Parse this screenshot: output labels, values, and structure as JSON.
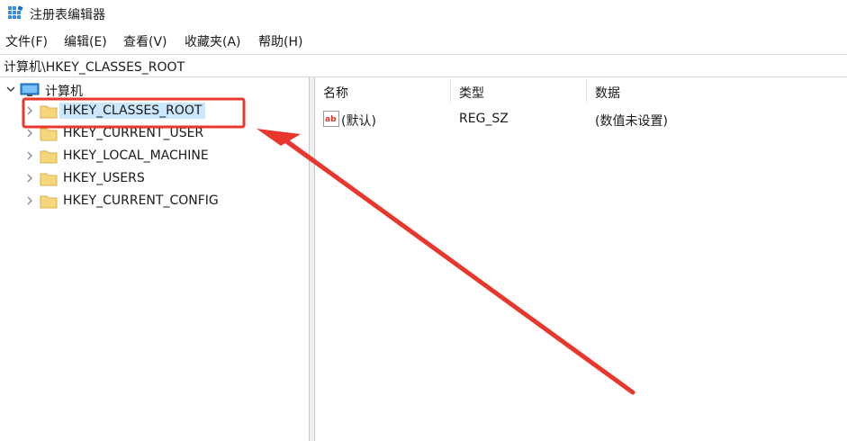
{
  "window": {
    "title": "注册表编辑器"
  },
  "menu": [
    {
      "label": "文件(F)"
    },
    {
      "label": "编辑(E)"
    },
    {
      "label": "查看(V)"
    },
    {
      "label": "收藏夹(A)"
    },
    {
      "label": "帮助(H)"
    }
  ],
  "address": {
    "path": "计算机\\HKEY_CLASSES_ROOT"
  },
  "tree": {
    "root": "计算机",
    "items": [
      {
        "label": "HKEY_CLASSES_ROOT",
        "selected": true
      },
      {
        "label": "HKEY_CURRENT_USER"
      },
      {
        "label": "HKEY_LOCAL_MACHINE"
      },
      {
        "label": "HKEY_USERS"
      },
      {
        "label": "HKEY_CURRENT_CONFIG"
      }
    ]
  },
  "values": {
    "columns": [
      "名称",
      "类型",
      "数据"
    ],
    "rows": [
      {
        "name": "(默认)",
        "type": "REG_SZ",
        "data": "(数值未设置)"
      }
    ]
  },
  "annotation": {
    "color": "#e8372c",
    "icon": "arrow-pointer"
  }
}
